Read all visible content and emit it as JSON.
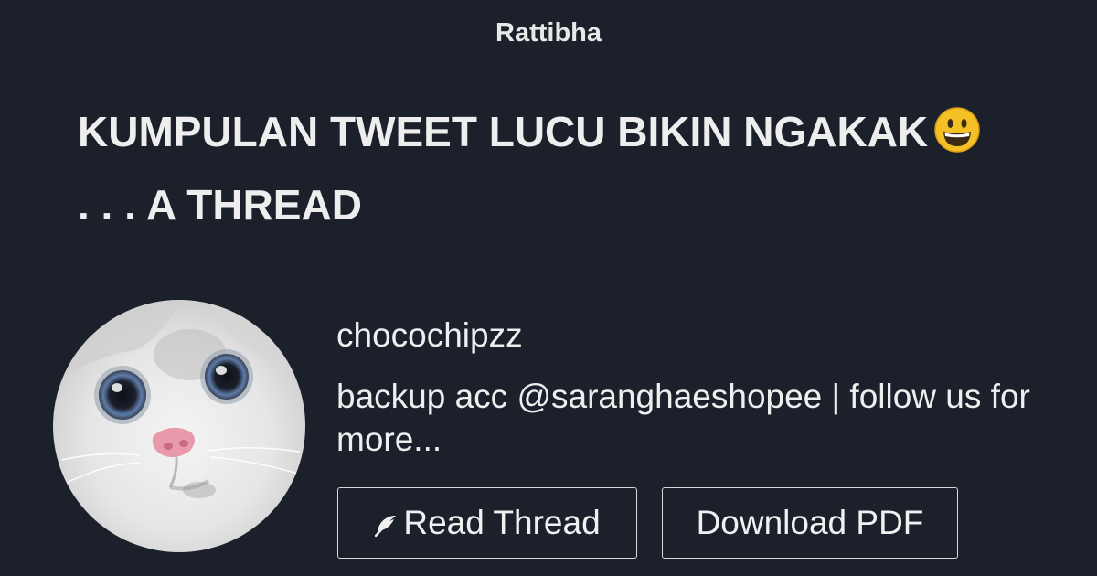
{
  "site": {
    "name": "Rattibha"
  },
  "thread": {
    "title": "KUMPULAN TWEET LUCU BIKIN NGAKAK",
    "title_line2": ". . . A THREAD"
  },
  "author": {
    "username": "chocochipzz",
    "bio": "backup acc @saranghaeshopee | follow us for more..."
  },
  "actions": {
    "read_label": "Read Thread",
    "pdf_label": "Download PDF"
  },
  "icons": {
    "title_emoji": "grinning-face-icon",
    "read_icon": "feather-icon"
  },
  "colors": {
    "background": "#1b202b",
    "text": "#eeeeee",
    "button_border": "#d8d8d8"
  }
}
